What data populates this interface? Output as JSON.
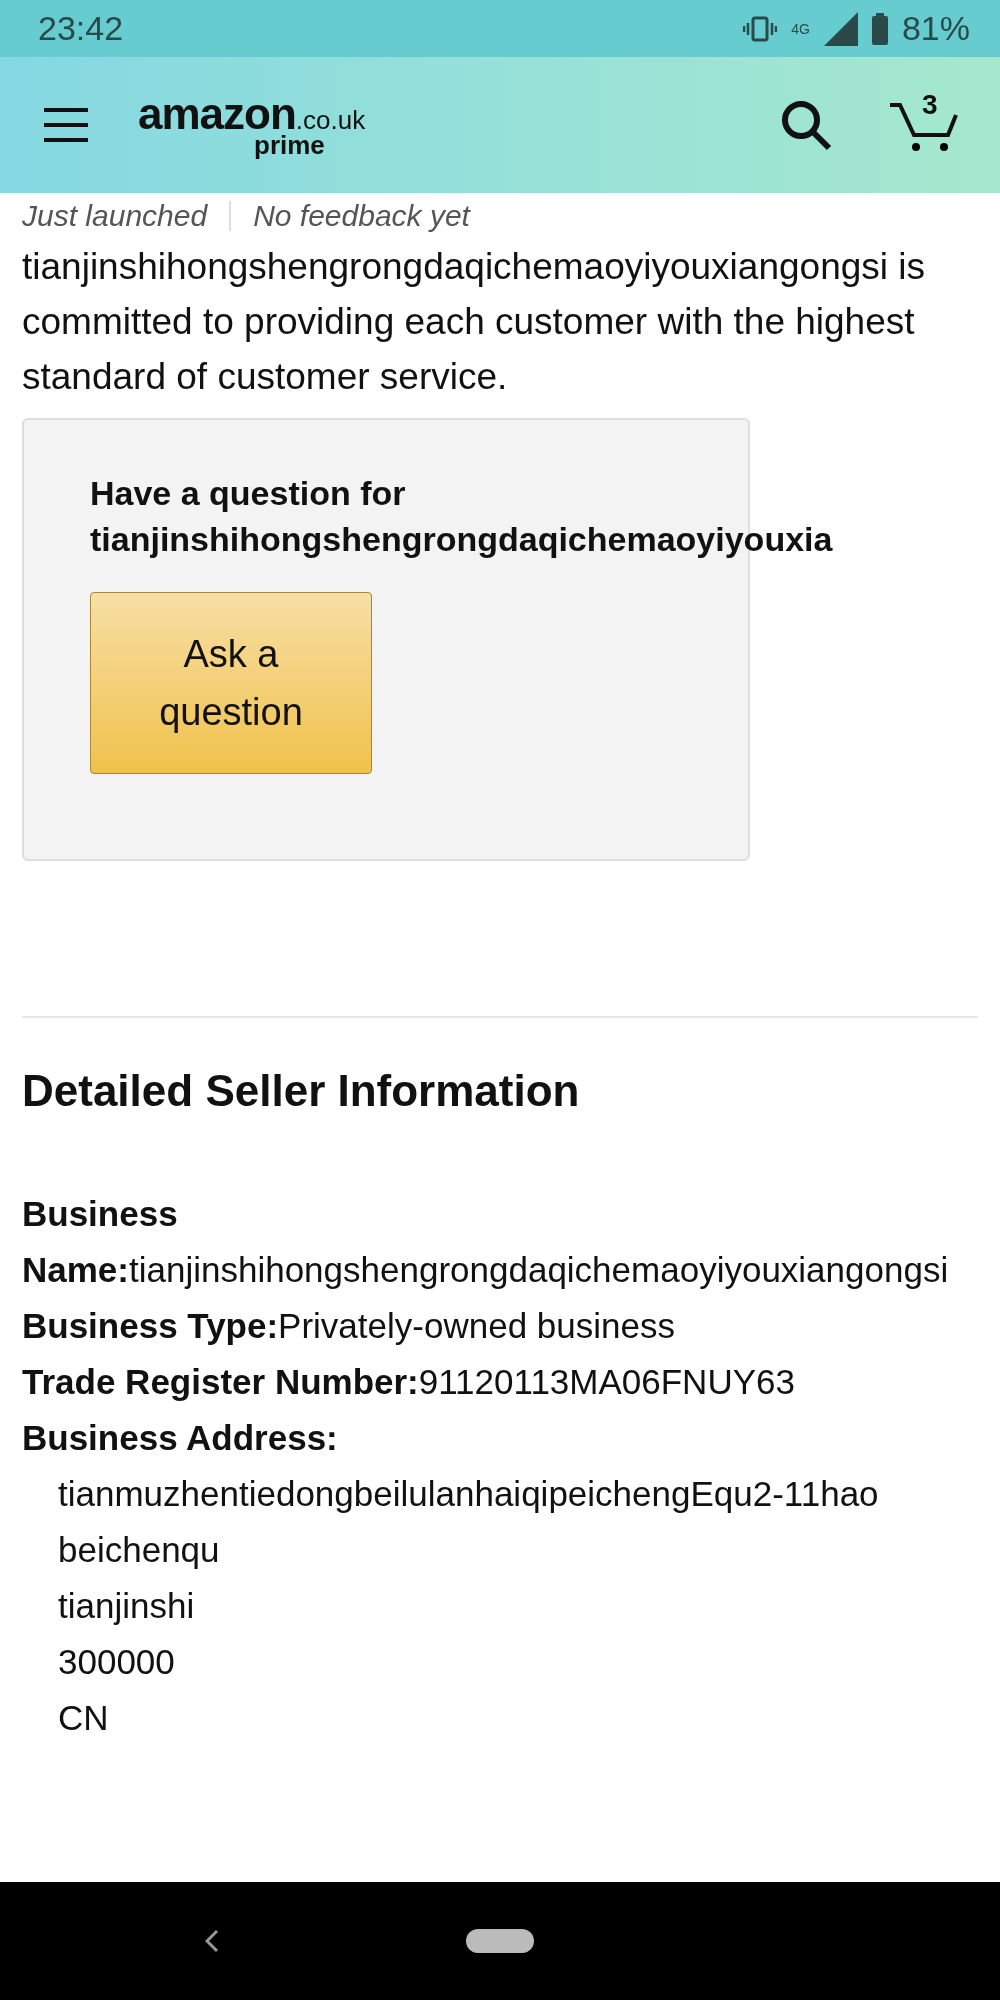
{
  "status_bar": {
    "time": "23:42",
    "battery": "81%",
    "network": "4G"
  },
  "header": {
    "logo": "amazon",
    "domain": ".co.uk",
    "tier": "prime",
    "cart_count": "3"
  },
  "seller_meta": [
    "Just launched",
    "No feedback yet"
  ],
  "intro": "tianjinshihongshengrongdaqichemaoyiyouxiangongsi is committed to providing each customer with the highest standard of customer service.",
  "question_box": {
    "heading": "Have a question for",
    "seller": "tianjinshihongshengrongdaqichemaoyiyouxia",
    "button": "Ask a question"
  },
  "details": {
    "title": "Detailed Seller Information",
    "fields": [
      {
        "label": "Business Name:",
        "value": "tianjinshihongshengrongdaqichemaoyiyouxiangongsi"
      },
      {
        "label": "Business Type:",
        "value": "Privately-owned business"
      },
      {
        "label": "Trade Register Number:",
        "value": "91120113MA06FNUY63"
      }
    ],
    "address_label": "Business Address:",
    "address_lines": [
      "tianmuzhentiedongbeilulanhaiqipeichengEqu2-11hao",
      "beichenqu",
      "tianjinshi",
      "300000",
      "CN"
    ]
  }
}
